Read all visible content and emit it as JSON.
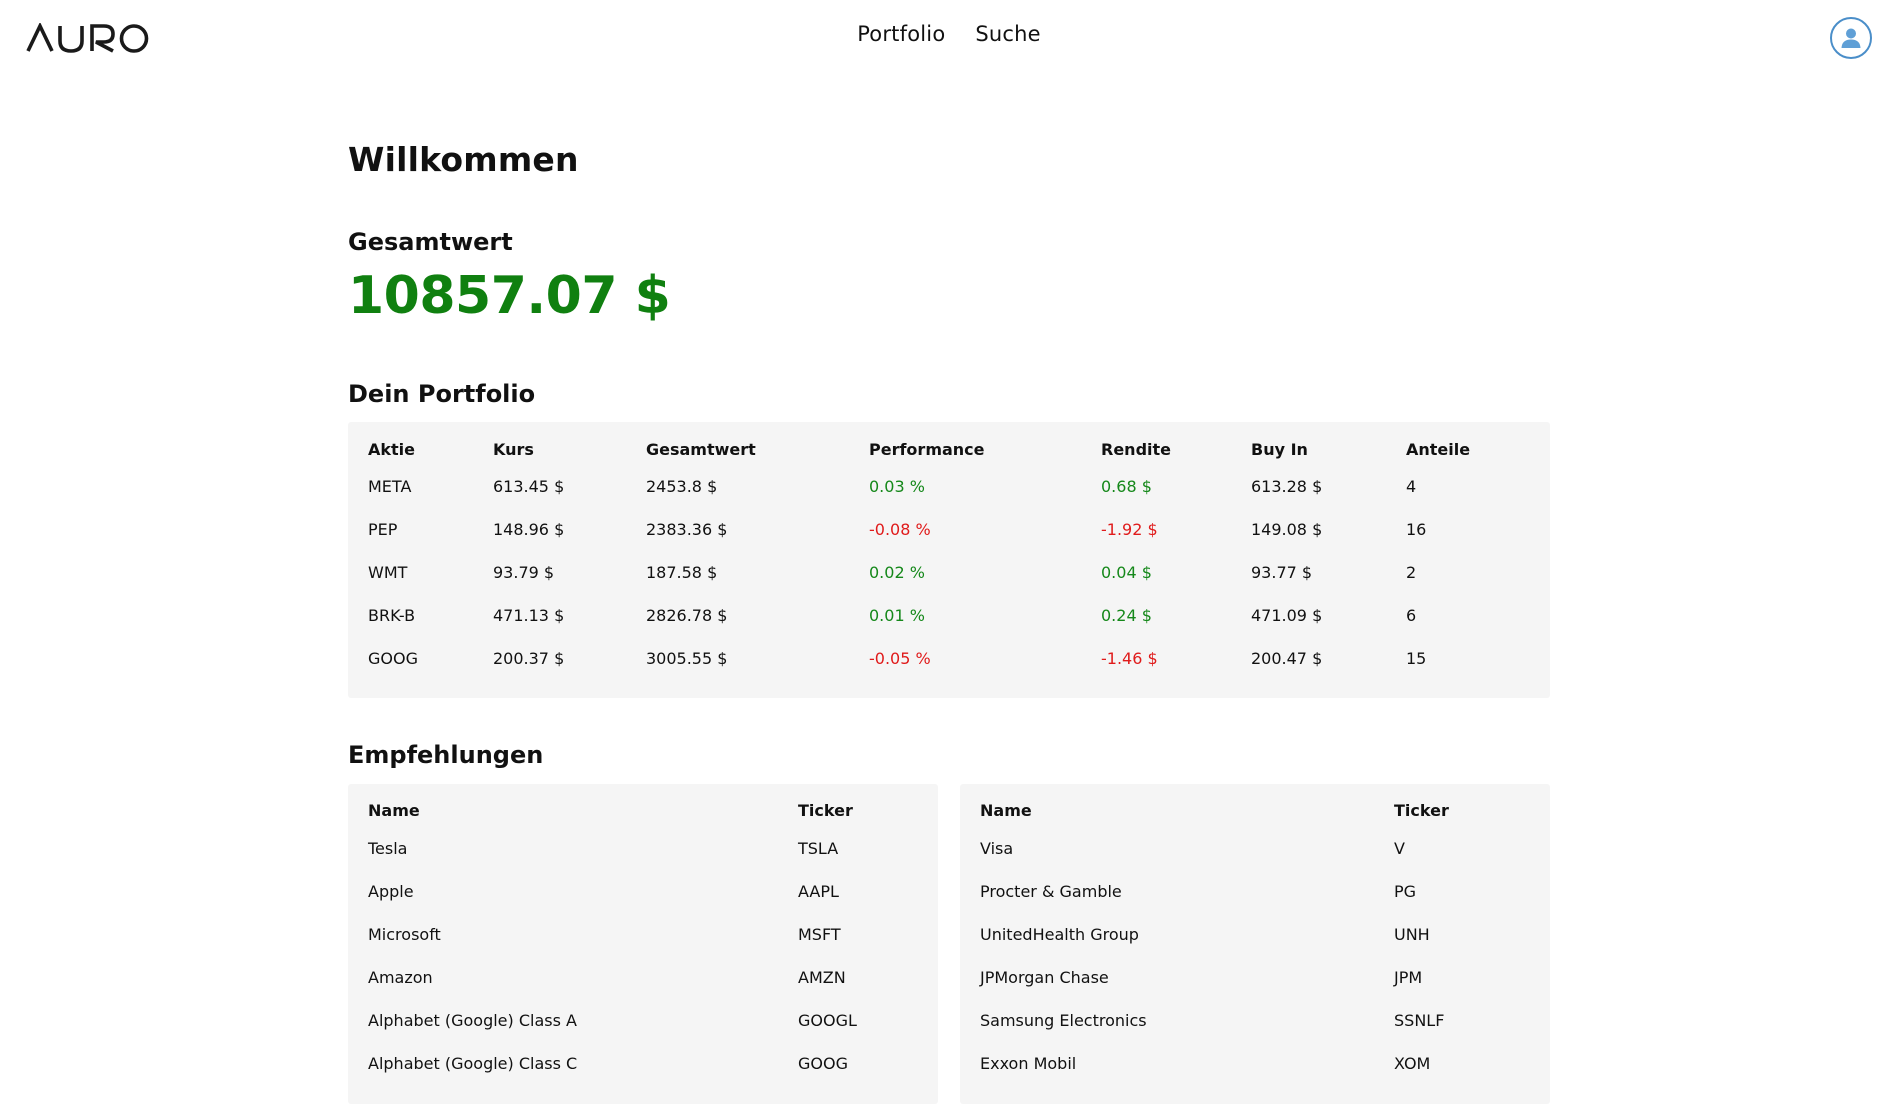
{
  "header": {
    "logo_text": "AURO",
    "nav": [
      "Portfolio",
      "Suche"
    ],
    "avatar_icon": "user-icon"
  },
  "welcome": "Willkommen",
  "total": {
    "label": "Gesamtwert",
    "value": "10857.07 $"
  },
  "portfolio": {
    "title": "Dein Portfolio",
    "columns": [
      "Aktie",
      "Kurs",
      "Gesamtwert",
      "Performance",
      "Rendite",
      "Buy In",
      "Anteile"
    ],
    "rows": [
      {
        "aktie": "META",
        "kurs": "613.45 $",
        "gesamtwert": "2453.8 $",
        "performance": "0.03 %",
        "rendite": "0.68 $",
        "buy_in": "613.28 $",
        "anteile": "4",
        "trend": "pos"
      },
      {
        "aktie": "PEP",
        "kurs": "148.96 $",
        "gesamtwert": "2383.36 $",
        "performance": "-0.08 %",
        "rendite": "-1.92 $",
        "buy_in": "149.08 $",
        "anteile": "16",
        "trend": "neg"
      },
      {
        "aktie": "WMT",
        "kurs": "93.79 $",
        "gesamtwert": "187.58 $",
        "performance": "0.02 %",
        "rendite": "0.04 $",
        "buy_in": "93.77 $",
        "anteile": "2",
        "trend": "pos"
      },
      {
        "aktie": "BRK-B",
        "kurs": "471.13 $",
        "gesamtwert": "2826.78 $",
        "performance": "0.01 %",
        "rendite": "0.24 $",
        "buy_in": "471.09 $",
        "anteile": "6",
        "trend": "pos"
      },
      {
        "aktie": "GOOG",
        "kurs": "200.37 $",
        "gesamtwert": "3005.55 $",
        "performance": "-0.05 %",
        "rendite": "-1.46 $",
        "buy_in": "200.47 $",
        "anteile": "15",
        "trend": "neg"
      }
    ]
  },
  "recommendations": {
    "title": "Empfehlungen",
    "left": {
      "columns": [
        "Name",
        "Ticker"
      ],
      "rows": [
        {
          "name": "Tesla",
          "ticker": "TSLA"
        },
        {
          "name": "Apple",
          "ticker": "AAPL"
        },
        {
          "name": "Microsoft",
          "ticker": "MSFT"
        },
        {
          "name": "Amazon",
          "ticker": "AMZN"
        },
        {
          "name": "Alphabet (Google) Class A",
          "ticker": "GOOGL"
        },
        {
          "name": "Alphabet (Google) Class C",
          "ticker": "GOOG"
        }
      ]
    },
    "right": {
      "columns": [
        "Name",
        "Ticker"
      ],
      "rows": [
        {
          "name": "Visa",
          "ticker": "V"
        },
        {
          "name": "Procter & Gamble",
          "ticker": "PG"
        },
        {
          "name": "UnitedHealth Group",
          "ticker": "UNH"
        },
        {
          "name": "JPMorgan Chase",
          "ticker": "JPM"
        },
        {
          "name": "Samsung Electronics",
          "ticker": "SSNLF"
        },
        {
          "name": "Exxon Mobil",
          "ticker": "XOM"
        }
      ]
    }
  },
  "colors": {
    "positive": "#15881a",
    "negative": "#e01b1b",
    "total_value": "#108010",
    "panel_bg": "#f5f5f5",
    "avatar_accent": "#4a8ec9"
  }
}
